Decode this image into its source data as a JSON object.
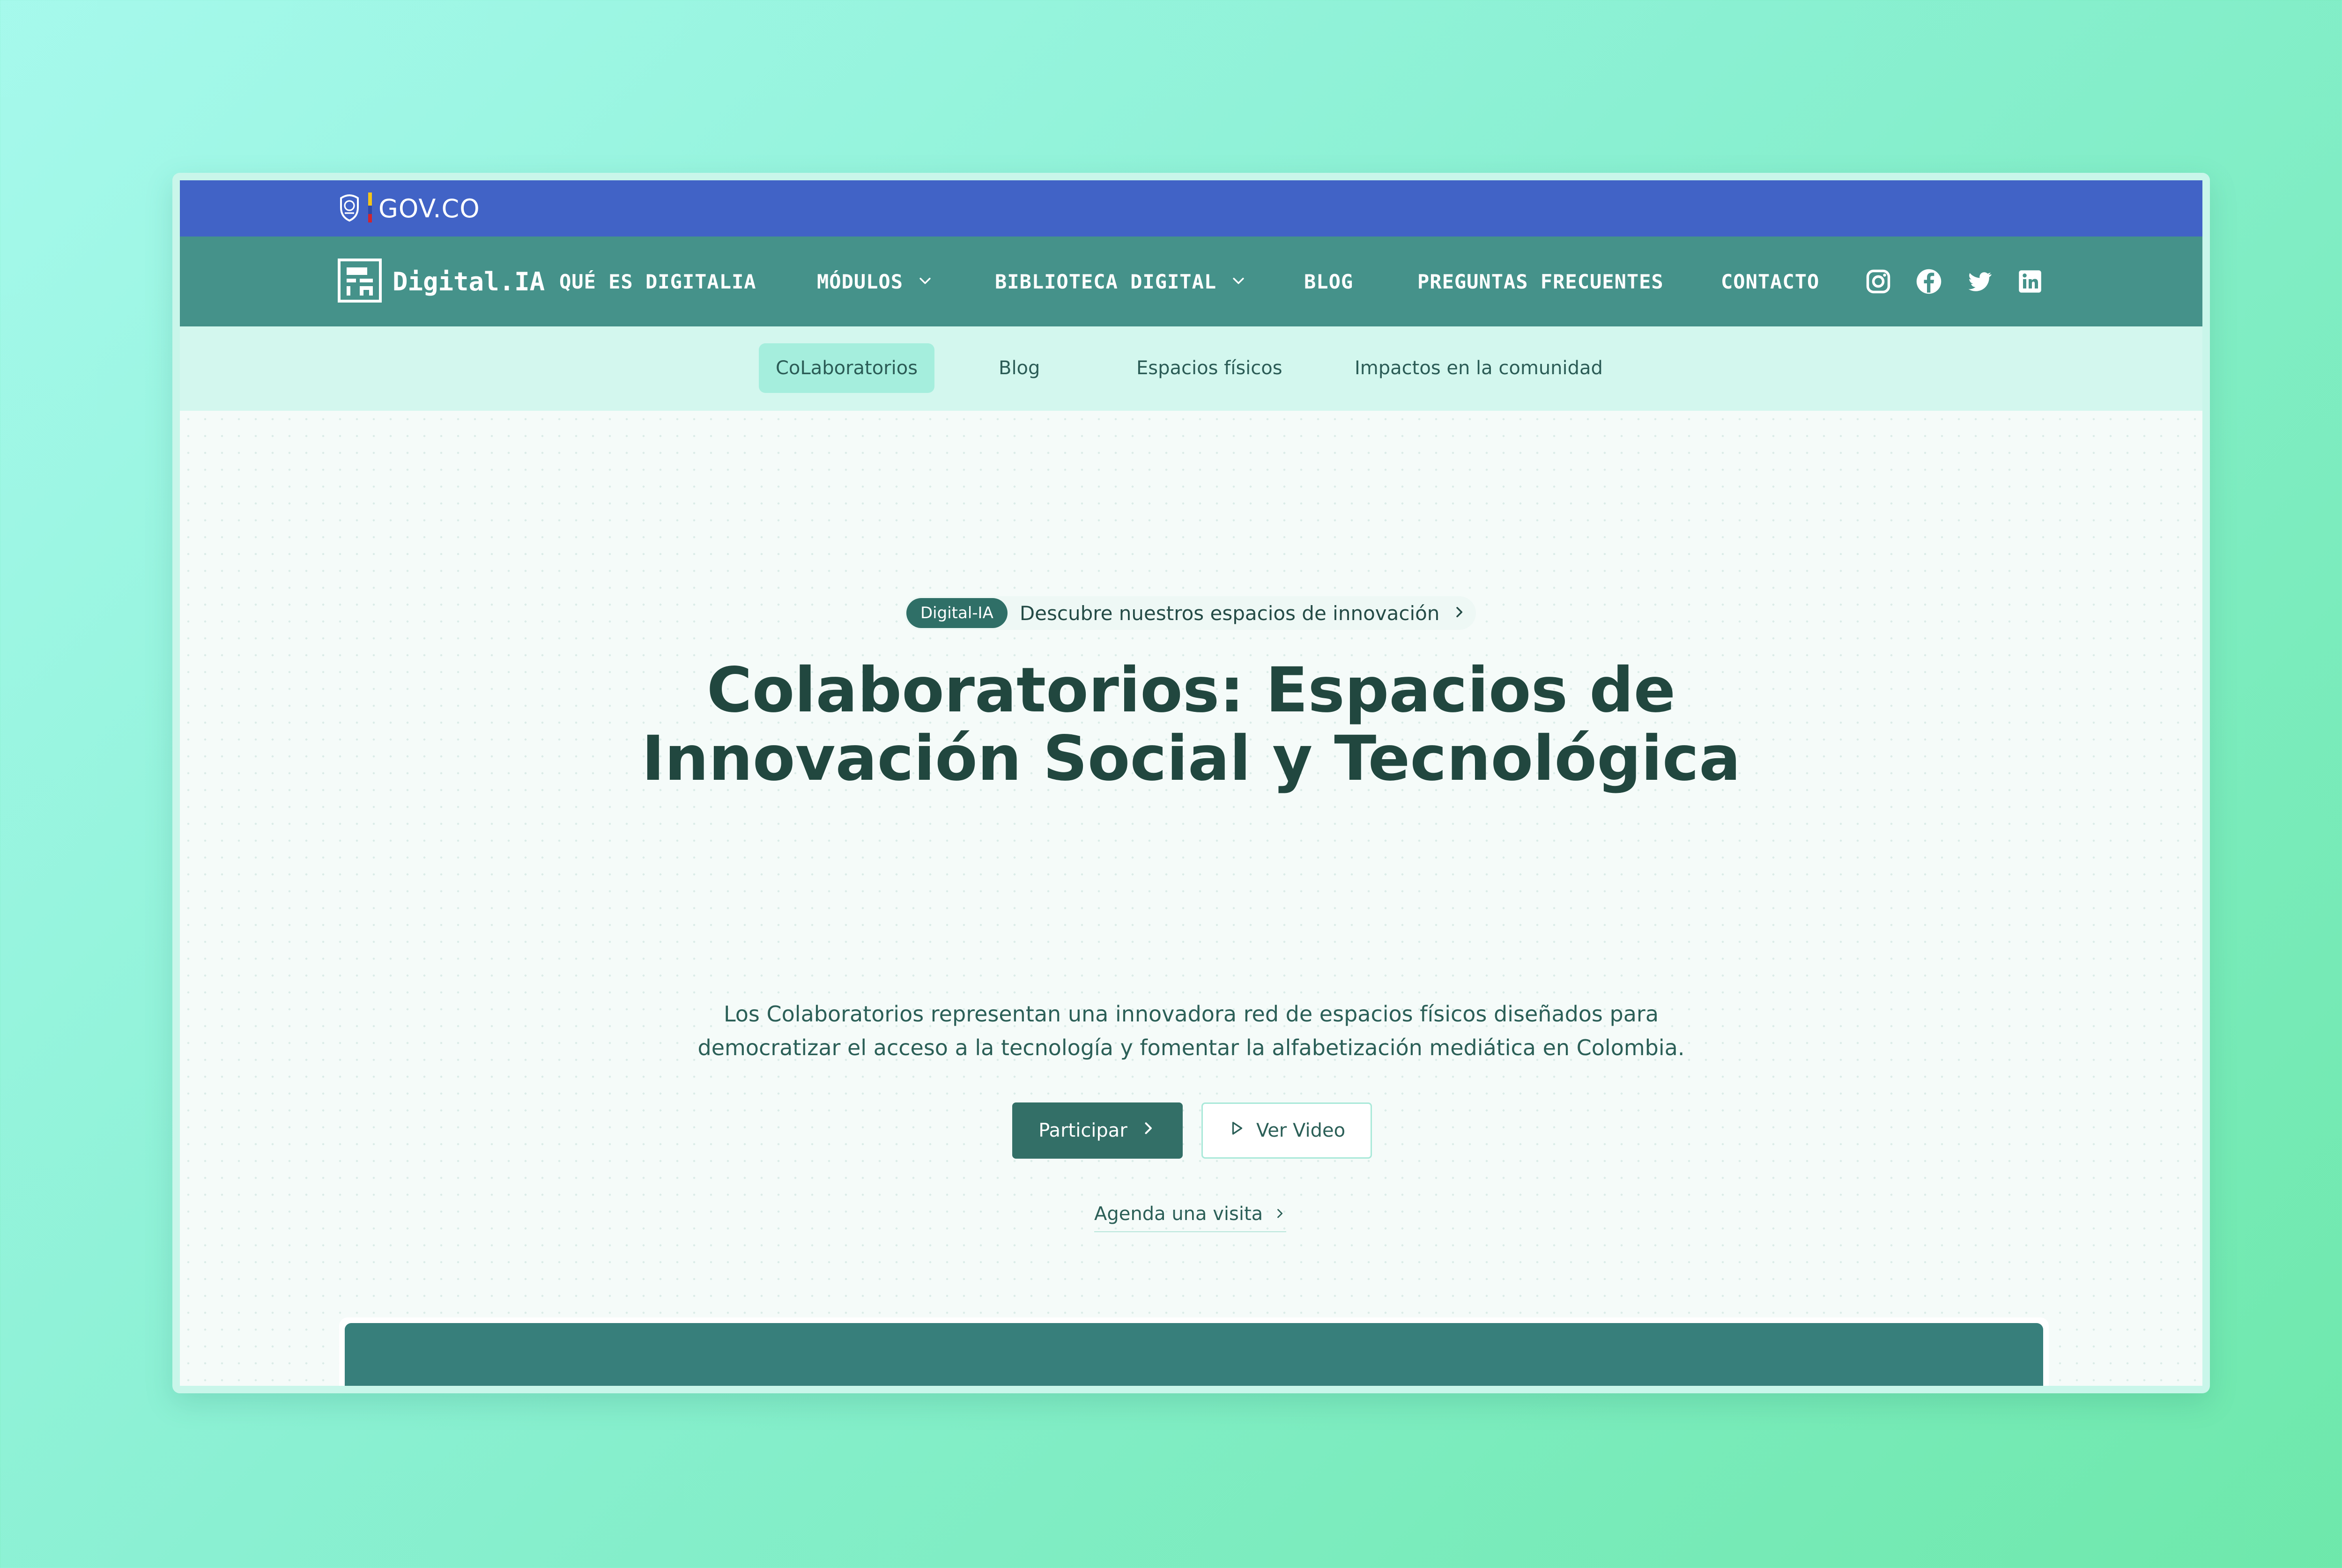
{
  "gov_bar": {
    "label": "GOV.CO"
  },
  "brand": {
    "name": "Digital.IA"
  },
  "nav": {
    "items": [
      {
        "label": "QUÉ ES DIGITALIA",
        "has_dropdown": false
      },
      {
        "label": "MÓDULOS",
        "has_dropdown": true
      },
      {
        "label": "BIBLIOTECA DIGITAL",
        "has_dropdown": true
      },
      {
        "label": "BLOG",
        "has_dropdown": false
      },
      {
        "label": "PREGUNTAS FRECUENTES",
        "has_dropdown": false
      },
      {
        "label": "CONTACTO",
        "has_dropdown": false
      }
    ],
    "social": [
      "instagram-icon",
      "facebook-icon",
      "twitter-icon",
      "linkedin-icon"
    ]
  },
  "subnav": {
    "items": [
      {
        "label": "CoLaboratorios",
        "active": true
      },
      {
        "label": "Blog",
        "active": false
      },
      {
        "label": "Espacios físicos",
        "active": false
      },
      {
        "label": "Impactos en la comunidad",
        "active": false
      }
    ]
  },
  "hero": {
    "badge": {
      "pill": "Digital-IA",
      "text": "Descubre nuestros espacios de innovación"
    },
    "title_line1": "Colaboratorios: Espacios de",
    "title_line2": "Innovación Social y Tecnológica",
    "subtitle_line1": "Los Colaboratorios representan una innovadora red de espacios físicos diseñados para",
    "subtitle_line2": "democratizar el acceso a la tecnología y fomentar la alfabetización mediática en Colombia.",
    "primary_button": "Participar",
    "secondary_button": "Ver Video",
    "link": "Agenda una visita"
  },
  "colors": {
    "gov_bar": "#4163c6",
    "nav_bar": "#45928a",
    "subnav_bg": "#d3f7ee",
    "subnav_active": "#a5eedd",
    "heading": "#21473f",
    "primary_button": "#336f67",
    "media_block": "#377f7b"
  }
}
